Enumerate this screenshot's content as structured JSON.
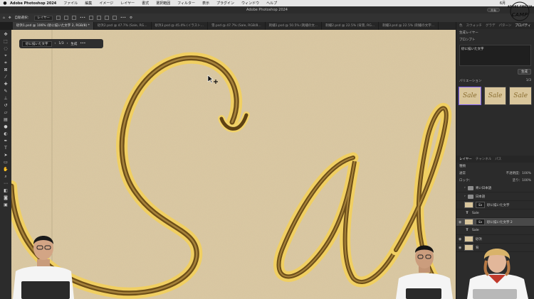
{
  "menubar": {
    "app": "Adobe Photoshop 2024",
    "items": [
      "ファイル",
      "編集",
      "イメージ",
      "レイヤー",
      "書式",
      "選択範囲",
      "フィルター",
      "表示",
      "プラグイン",
      "ウィンドウ",
      "ヘルプ"
    ],
    "clock": "6月"
  },
  "titlebar": {
    "title": "Adobe Photoshop 2024",
    "share_label": "共有"
  },
  "options": {
    "auto_select": "自動選択：",
    "target": "レイヤー"
  },
  "tabs": [
    {
      "label": "砂浜1.psd @ 106% (砂に描いた文字 2, RGB/8) *",
      "active": true
    },
    {
      "label": "砂浜2.psd @ 47.7% (Sale, RG...",
      "active": false
    },
    {
      "label": "砂浜3.psd @ 45.4% (イラスト...",
      "active": false
    },
    {
      "label": "雪.psd @ 47.7% (Sale, RGB/8...",
      "active": false
    },
    {
      "label": "刺繍1.psd @ 50.5% (刺繍の文...",
      "active": false
    },
    {
      "label": "刺繍2.psd @ 22.5% (背景, RG...",
      "active": false
    },
    {
      "label": "刺繍3.psd @ 22.5% (刺繍の文字...",
      "active": false
    }
  ],
  "taskbar": {
    "prompt": "砂に描いた文字",
    "counter": "1/3",
    "generate": "生成"
  },
  "panel": {
    "tabs": [
      "色",
      "スウォッチ",
      "グラデ",
      "パターン",
      "プロパティ"
    ],
    "section_title": "生成レイヤー",
    "prompt_label": "プロンプト",
    "prompt_value": "砂に描いた文字",
    "generate_label": "生成",
    "variations_label": "バリエーション",
    "variations_count": "1/3",
    "variation_text": "Sale",
    "layers_tabs": [
      "レイヤー",
      "チャンネル",
      "パス"
    ],
    "kind_label": "種類",
    "blend_mode": "通常",
    "opacity_label": "不透明度：",
    "opacity_value": "100%",
    "lock_label": "ロック：",
    "fill_label": "塗り：",
    "fill_value": "100%",
    "layers": [
      {
        "name": "青い日本語",
        "type": "folder",
        "selected": false,
        "visible": false
      },
      {
        "name": "日本語",
        "type": "folder",
        "selected": false,
        "visible": false
      },
      {
        "name": "砂に描いた文字",
        "type": "generated",
        "selected": false,
        "visible": false
      },
      {
        "name": "Sale",
        "type": "text",
        "selected": false,
        "visible": false
      },
      {
        "name": "砂に描いた文字 2",
        "type": "generated",
        "selected": true,
        "visible": true
      },
      {
        "name": "Sale",
        "type": "text",
        "selected": false,
        "visible": false
      },
      {
        "name": "砂浜",
        "type": "image",
        "selected": false,
        "visible": true
      },
      {
        "name": "背",
        "type": "image",
        "selected": false,
        "visible": true
      }
    ]
  },
  "logo": {
    "text_top": "ADOBE FIREFLY",
    "text_main": "CAMP"
  },
  "colors": {
    "sand": "#d9c7a0",
    "groove": "#7a5a1e",
    "highlight": "#f2d36a",
    "accent": "#7a5cf0"
  }
}
